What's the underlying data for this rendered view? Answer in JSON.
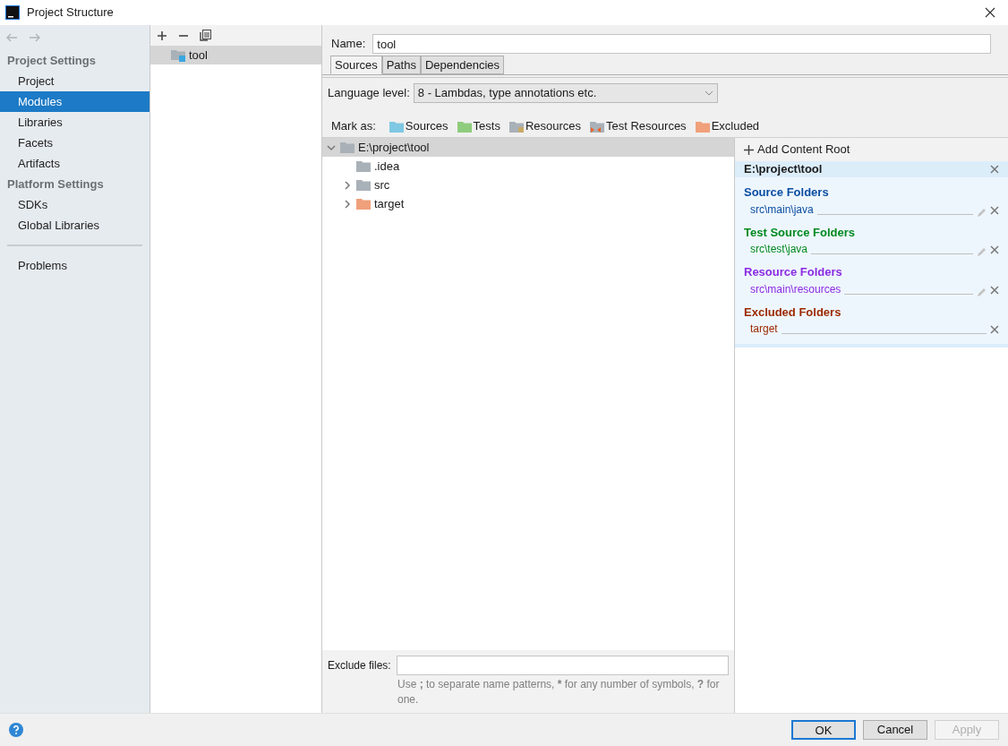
{
  "window": {
    "title": "Project Structure"
  },
  "sidebar": {
    "sections": [
      {
        "title": "Project Settings",
        "items": [
          {
            "label": "Project",
            "selected": false
          },
          {
            "label": "Modules",
            "selected": true
          },
          {
            "label": "Libraries",
            "selected": false
          },
          {
            "label": "Facets",
            "selected": false
          },
          {
            "label": "Artifacts",
            "selected": false
          }
        ]
      },
      {
        "title": "Platform Settings",
        "items": [
          {
            "label": "SDKs",
            "selected": false
          },
          {
            "label": "Global Libraries",
            "selected": false
          }
        ]
      }
    ],
    "bottom_items": [
      {
        "label": "Problems",
        "selected": false
      }
    ]
  },
  "modules": [
    {
      "label": "tool",
      "selected": true
    }
  ],
  "name_field": {
    "label": "Name:",
    "value": "tool"
  },
  "tabs": [
    {
      "label": "Sources",
      "selected": true
    },
    {
      "label": "Paths",
      "selected": false
    },
    {
      "label": "Dependencies",
      "selected": false
    }
  ],
  "language_level": {
    "label": "Language level:",
    "value": "8 - Lambdas, type annotations etc."
  },
  "mark_as": {
    "label": "Mark as:",
    "items": [
      {
        "label": "Sources",
        "kind": "sources"
      },
      {
        "label": "Tests",
        "kind": "tests"
      },
      {
        "label": "Resources",
        "kind": "resources"
      },
      {
        "label": "Test Resources",
        "kind": "testresources"
      },
      {
        "label": "Excluded",
        "kind": "excluded"
      }
    ]
  },
  "tree": [
    {
      "label": "E:\\project\\tool",
      "kind": "plain",
      "expanded": true,
      "selected": true,
      "children": [
        {
          "label": ".idea",
          "kind": "plain",
          "selected": false
        },
        {
          "label": "src",
          "kind": "plain",
          "expanded": false,
          "selected": false
        },
        {
          "label": "target",
          "kind": "excluded",
          "expanded": false,
          "selected": false
        }
      ]
    }
  ],
  "exclude_files": {
    "label": "Exclude files:",
    "hint": "Use **;** to separate name patterns, ***** for any number of symbols, **?** for one."
  },
  "content_root": {
    "add_label": "Add Content Root",
    "path": "E:\\project\\tool",
    "groups": [
      {
        "title": "Source Folders",
        "color": "#0b4ea2",
        "folders": [
          {
            "path": "src\\main\\java",
            "editable": true
          }
        ]
      },
      {
        "title": "Test Source Folders",
        "color": "#008a20",
        "folders": [
          {
            "path": "src\\test\\java",
            "editable": true
          }
        ]
      },
      {
        "title": "Resource Folders",
        "color": "#8a2be2",
        "folders": [
          {
            "path": "src\\main\\resources",
            "editable": true
          }
        ]
      },
      {
        "title": "Excluded Folders",
        "color": "#9c2a00",
        "folders": [
          {
            "path": "target",
            "editable": false
          }
        ]
      }
    ]
  },
  "buttons": [
    {
      "label": "OK",
      "kind": "default",
      "disabled": false
    },
    {
      "label": "Cancel",
      "kind": "normal",
      "disabled": false
    },
    {
      "label": "Apply",
      "kind": "normal",
      "disabled": true
    }
  ]
}
